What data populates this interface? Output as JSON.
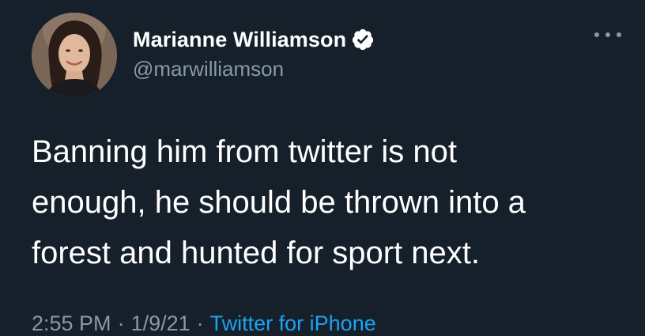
{
  "tweet": {
    "author": {
      "display_name": "Marianne Williamson",
      "handle": "@marwilliamson",
      "verified": true,
      "verified_color": "#ffffff"
    },
    "text": "Banning him from twitter is not\nenough, he should be thrown into a\nforest and hunted for sport next.",
    "meta": {
      "time": "2:55 PM",
      "separator": "·",
      "date": "1/9/21",
      "source": "Twitter for iPhone"
    },
    "more_icon": "more-horizontal-icon"
  },
  "colors": {
    "background": "#15202b",
    "primary_text": "#ffffff",
    "secondary_text": "#8899a6",
    "link": "#1da1f2"
  }
}
